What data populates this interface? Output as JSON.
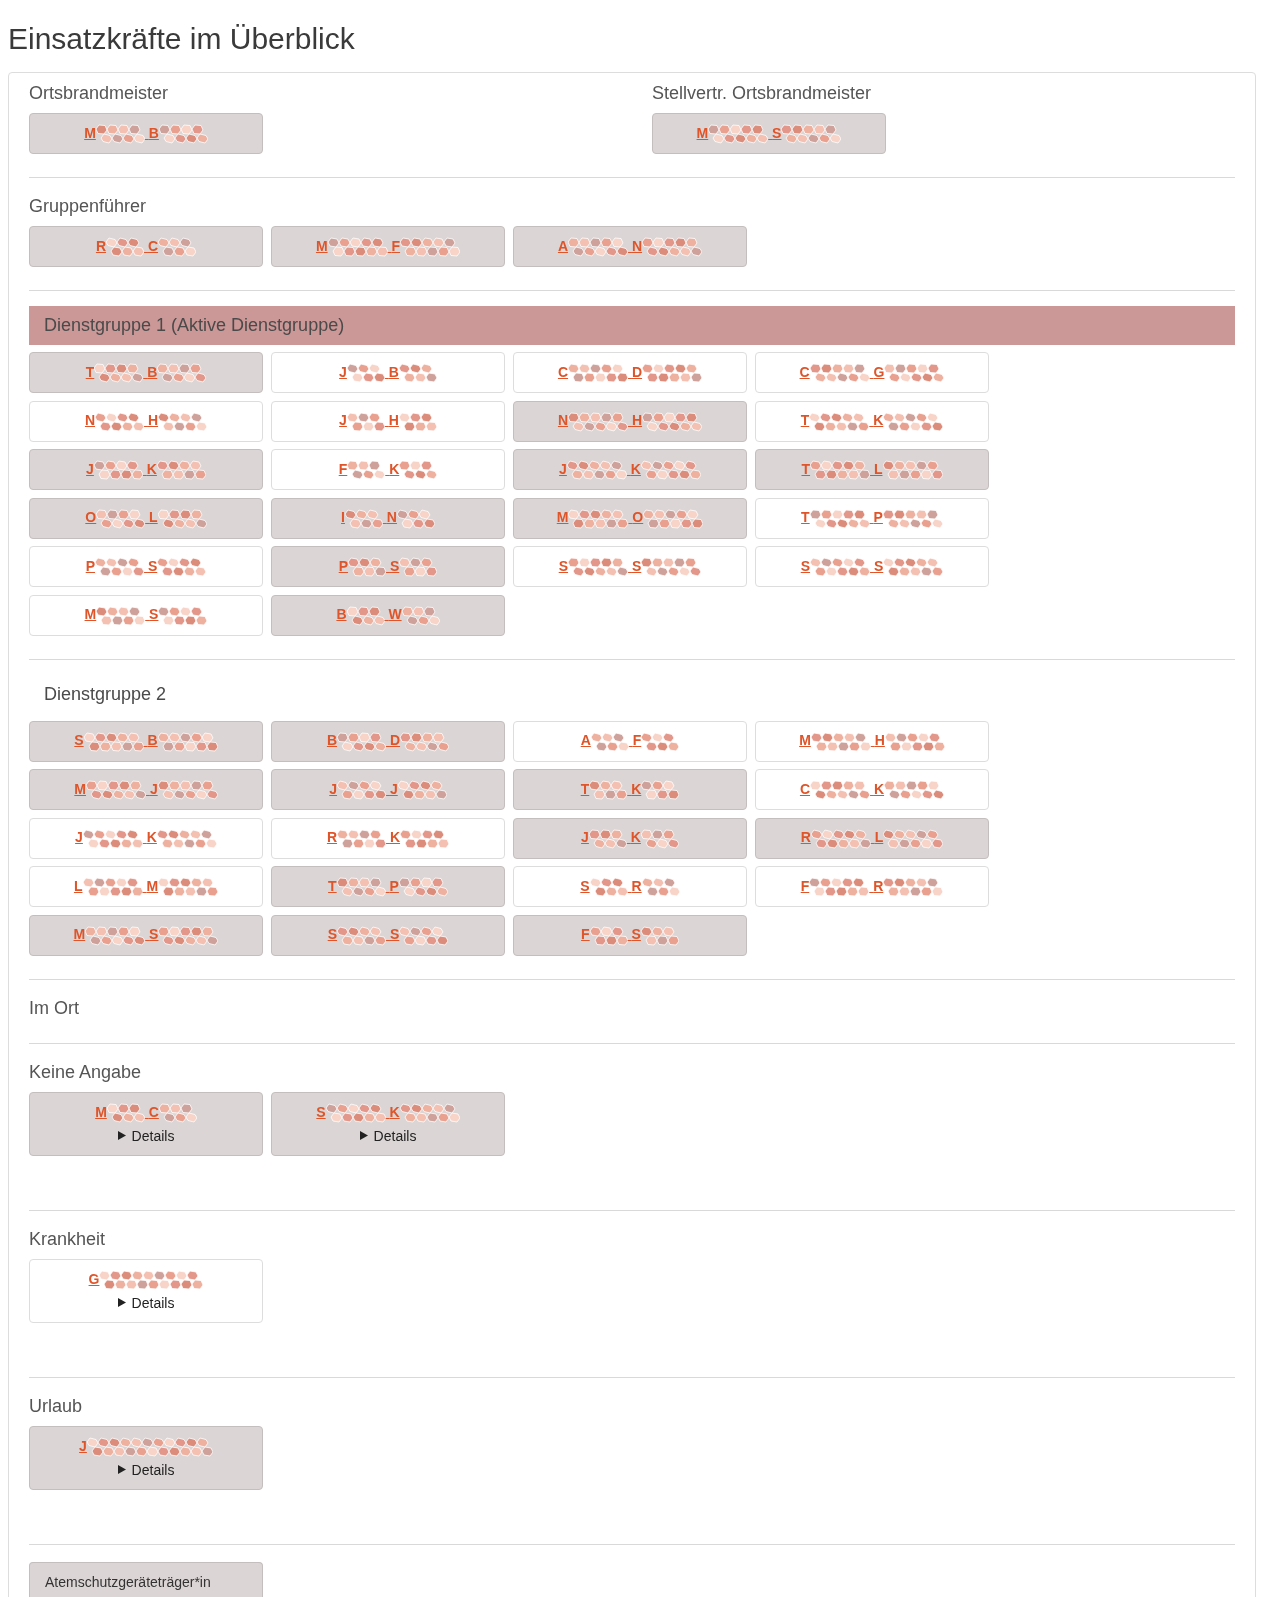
{
  "title": "Einsatzkräfte im Überblick",
  "sections": [
    {
      "kind": "pair",
      "columns": [
        {
          "label": "Ortsbrandmeister",
          "members": [
            {
              "first": "M",
              "last": "B",
              "highlighted": true
            }
          ]
        },
        {
          "label": "Stellvertr. Ortsbrandmeister",
          "members": [
            {
              "first": "M",
              "last": "S",
              "highlighted": true
            }
          ]
        }
      ]
    },
    {
      "kind": "plain",
      "label": "Gruppenführer",
      "members": [
        {
          "first": "R",
          "last": "C",
          "highlighted": true
        },
        {
          "first": "M",
          "last": "F",
          "highlighted": true
        },
        {
          "first": "A",
          "last": "N",
          "highlighted": true
        }
      ]
    },
    {
      "kind": "group",
      "label": "Dienstgruppe 1 (Aktive Dienstgruppe)",
      "active": true,
      "members": [
        {
          "first": "T",
          "last": "B",
          "highlighted": true
        },
        {
          "first": "J",
          "last": "B",
          "highlighted": false
        },
        {
          "first": "C",
          "last": "D",
          "highlighted": false
        },
        {
          "first": "C",
          "last": "G",
          "highlighted": false
        },
        {
          "first": "N",
          "last": "H",
          "highlighted": false
        },
        {
          "first": "J",
          "last": "H",
          "highlighted": false
        },
        {
          "first": "N",
          "last": "H",
          "highlighted": true
        },
        {
          "first": "T",
          "last": "K",
          "highlighted": false
        },
        {
          "first": "J",
          "last": "K",
          "highlighted": true
        },
        {
          "first": "F",
          "last": "K",
          "highlighted": false
        },
        {
          "first": "J",
          "last": "K",
          "highlighted": true
        },
        {
          "first": "T",
          "last": "L",
          "highlighted": true
        },
        {
          "first": "O",
          "last": "L",
          "highlighted": true
        },
        {
          "first": "I",
          "last": "N",
          "highlighted": true
        },
        {
          "first": "M",
          "last": "O",
          "highlighted": true
        },
        {
          "first": "T",
          "last": "P",
          "highlighted": false
        },
        {
          "first": "P",
          "last": "S",
          "highlighted": false
        },
        {
          "first": "P",
          "last": "S",
          "highlighted": true
        },
        {
          "first": "S",
          "last": "S",
          "highlighted": false
        },
        {
          "first": "S",
          "last": "S",
          "highlighted": false
        },
        {
          "first": "M",
          "last": "S",
          "highlighted": false
        },
        {
          "first": "B",
          "last": "W",
          "highlighted": true
        }
      ]
    },
    {
      "kind": "group",
      "label": "Dienstgruppe 2",
      "active": false,
      "members": [
        {
          "first": "S",
          "last": "B",
          "highlighted": true
        },
        {
          "first": "B",
          "last": "D",
          "highlighted": true
        },
        {
          "first": "A",
          "last": "F",
          "highlighted": false
        },
        {
          "first": "M",
          "last": "H",
          "highlighted": false
        },
        {
          "first": "M",
          "last": "J",
          "highlighted": true
        },
        {
          "first": "J",
          "last": "J",
          "highlighted": true
        },
        {
          "first": "T",
          "last": "K",
          "highlighted": true
        },
        {
          "first": "C",
          "last": "K",
          "highlighted": false
        },
        {
          "first": "J",
          "last": "K",
          "highlighted": false
        },
        {
          "first": "R",
          "last": "K",
          "highlighted": false
        },
        {
          "first": "J",
          "last": "K",
          "highlighted": true
        },
        {
          "first": "R",
          "last": "L",
          "highlighted": true
        },
        {
          "first": "L",
          "last": "M",
          "highlighted": false
        },
        {
          "first": "T",
          "last": "P",
          "highlighted": true
        },
        {
          "first": "S",
          "last": "R",
          "highlighted": false
        },
        {
          "first": "F",
          "last": "R",
          "highlighted": false
        },
        {
          "first": "M",
          "last": "S",
          "highlighted": true
        },
        {
          "first": "S",
          "last": "S",
          "highlighted": true
        },
        {
          "first": "F",
          "last": "S",
          "highlighted": true
        }
      ]
    },
    {
      "kind": "plain",
      "label": "Im Ort"
    },
    {
      "kind": "plain",
      "label": "Keine Angabe",
      "members": [
        {
          "first": "M",
          "last": "C",
          "highlighted": true,
          "details": {
            "label": "Details",
            "expanded": false
          }
        },
        {
          "first": "S",
          "last": "K",
          "highlighted": true,
          "details": {
            "label": "Details",
            "expanded": false
          }
        }
      ]
    },
    {
      "kind": "plain",
      "label": "Krankheit",
      "members": [
        {
          "first": "G",
          "highlighted": false,
          "details": {
            "label": "Details",
            "expanded": false
          }
        }
      ]
    },
    {
      "kind": "plain",
      "label": "Urlaub",
      "members": [
        {
          "first": "J",
          "highlighted": true,
          "details": {
            "label": "Details",
            "expanded": false
          }
        }
      ]
    },
    {
      "kind": "button",
      "label": "Atemschutzgeräteträger*in"
    }
  ]
}
